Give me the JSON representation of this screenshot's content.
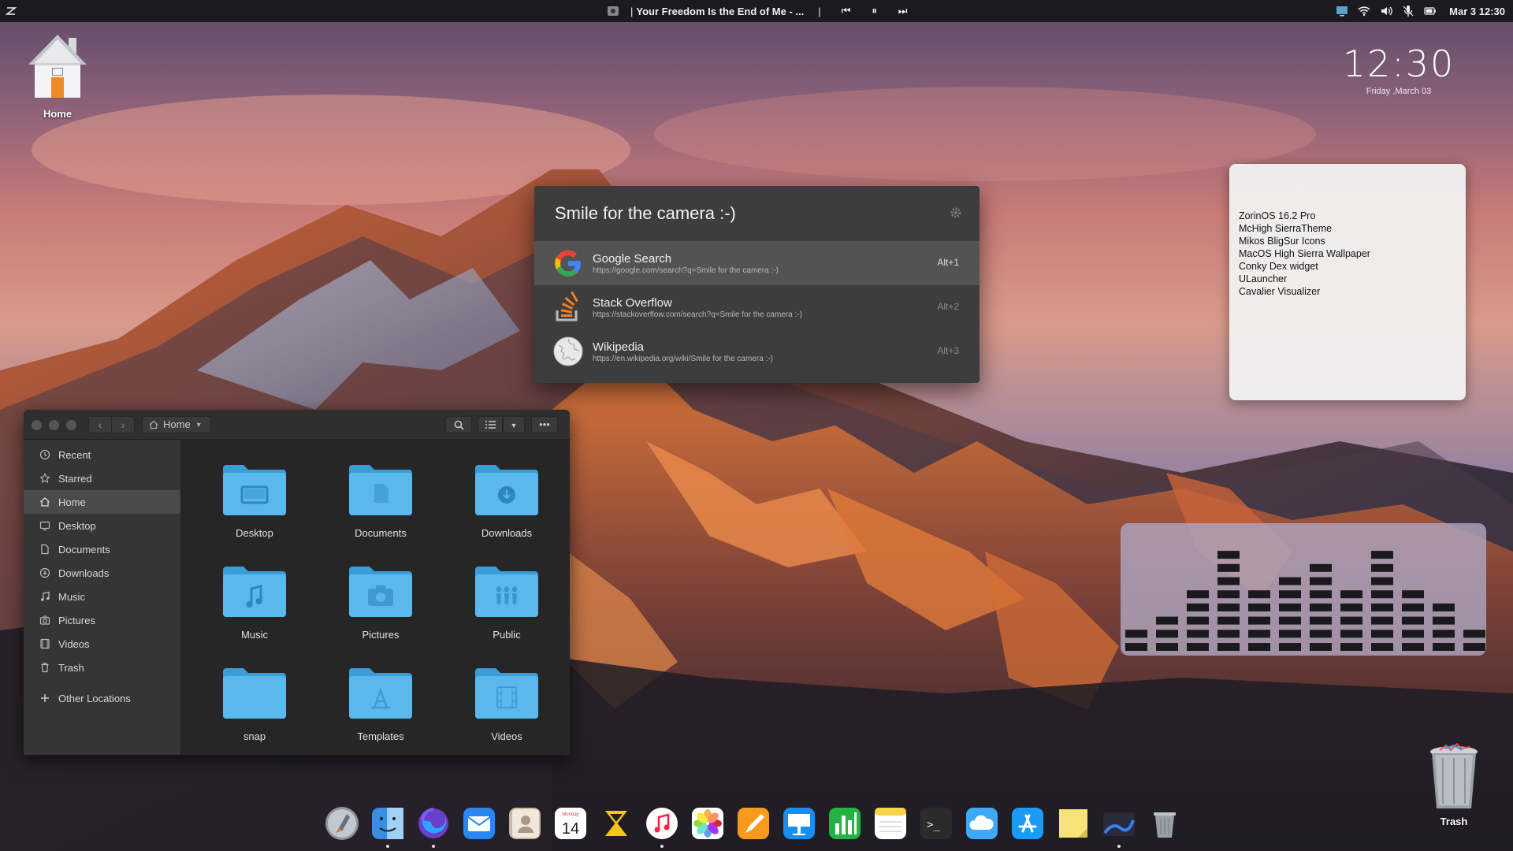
{
  "topbar": {
    "now_playing": "Your Freedom Is the End of Me - ...",
    "separator": "|",
    "prev_icon": "⏮",
    "pause_icon": "⏸",
    "next_icon": "⏭",
    "clock": "Mar 3  12:30",
    "status_icons": [
      "display-icon",
      "wifi-icon",
      "volume-icon",
      "microphone-icon",
      "battery-icon"
    ]
  },
  "desktop": {
    "home_label": "Home",
    "trash_label": "Trash"
  },
  "clock_widget": {
    "time": "12:30",
    "date": "Friday ,March 03"
  },
  "conky": {
    "lines": [
      "ZorinOS 16.2 Pro",
      "McHigh SierraTheme",
      "Mikos BligSur Icons",
      "MacOS High Sierra Wallpaper",
      "Conky Dex widget",
      "ULauncher",
      "Cavalier Visualizer"
    ]
  },
  "visualizer": {
    "levels": [
      2,
      3,
      5,
      8,
      5,
      6,
      7,
      5,
      8,
      5,
      4,
      2
    ]
  },
  "launcher": {
    "query": "Smile for the camera :-)",
    "results": [
      {
        "name": "Google Search",
        "url": "https://google.com/search?q=Smile for the camera :-)",
        "shortcut": "Alt+1"
      },
      {
        "name": "Stack Overflow",
        "url": "https://stackoverflow.com/search?q=Smile for the camera :-)",
        "shortcut": "Alt+2"
      },
      {
        "name": "Wikipedia",
        "url": "https://en.wikipedia.org/wiki/Smile for the camera :-)",
        "shortcut": "Alt+3"
      }
    ]
  },
  "files": {
    "path": "Home",
    "back_icon": "‹",
    "forward_icon": "›",
    "menu_icon": "•••",
    "sidebar": [
      {
        "label": "Recent",
        "icon": "clock-icon"
      },
      {
        "label": "Starred",
        "icon": "star-icon"
      },
      {
        "label": "Home",
        "icon": "home-icon"
      },
      {
        "label": "Desktop",
        "icon": "desktop-icon"
      },
      {
        "label": "Documents",
        "icon": "document-icon"
      },
      {
        "label": "Downloads",
        "icon": "download-icon"
      },
      {
        "label": "Music",
        "icon": "music-icon"
      },
      {
        "label": "Pictures",
        "icon": "camera-icon"
      },
      {
        "label": "Videos",
        "icon": "video-icon"
      },
      {
        "label": "Trash",
        "icon": "trash-icon"
      },
      {
        "label": "Other Locations",
        "icon": "plus-icon"
      }
    ],
    "folders": [
      "Desktop",
      "Documents",
      "Downloads",
      "Music",
      "Pictures",
      "Public",
      "snap",
      "Templates",
      "Videos"
    ]
  },
  "dock": {
    "apps": [
      "launchpad-icon",
      "finder-icon",
      "firefox-icon",
      "mail-icon",
      "contacts-icon",
      "calendar-icon",
      "rhythmbox-icon",
      "music-icon",
      "photos-icon",
      "pages-icon",
      "keynote-icon",
      "numbers-icon",
      "notes-icon",
      "terminal-icon",
      "icloud-icon",
      "app-store-icon",
      "stickies-icon",
      "cavalier-icon",
      "trash-icon"
    ],
    "calendar_day": "14",
    "calendar_weekday": "Monday",
    "terminal_prompt": ">_"
  },
  "colors": {
    "folder": "#5bb8ec",
    "folder_dark": "#3a9dd6",
    "launcher_bg": "#3d3d3d",
    "accent_orange": "#f07a2c"
  }
}
